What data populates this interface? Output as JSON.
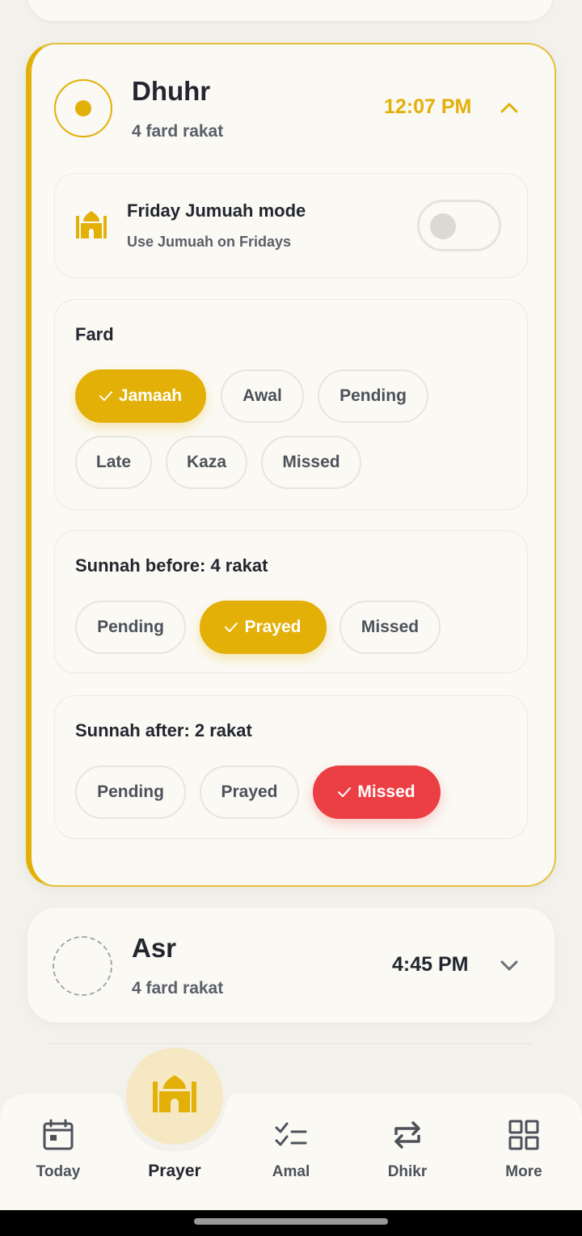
{
  "colors": {
    "accent": "#e2b007",
    "missed": "#ec3f44",
    "background": "#f3f1ec",
    "card": "#fbf9f4"
  },
  "dhuhr": {
    "name": "Dhuhr",
    "subtitle": "4 fard rakat",
    "time": "12:07 PM",
    "status_icon": "circle-dot-icon",
    "expand_icon": "chevron-up-icon",
    "jumuah": {
      "icon": "mosque-icon",
      "title": "Friday Jumuah mode",
      "subtitle": "Use Jumuah on Fridays",
      "enabled": false
    },
    "fard": {
      "title": "Fard",
      "options": [
        "Jamaah",
        "Awal",
        "Pending",
        "Late",
        "Kaza",
        "Missed"
      ],
      "selected": "Jamaah"
    },
    "sunnah_before": {
      "title": "Sunnah before: 4 rakat",
      "options": [
        "Pending",
        "Prayed",
        "Missed"
      ],
      "selected": "Prayed"
    },
    "sunnah_after": {
      "title": "Sunnah after: 2 rakat",
      "options": [
        "Pending",
        "Prayed",
        "Missed"
      ],
      "selected": "Missed"
    }
  },
  "asr": {
    "name": "Asr",
    "subtitle": "4 fard rakat",
    "time": "4:45 PM",
    "expand_icon": "chevron-down-icon"
  },
  "nav": {
    "items": [
      {
        "label": "Today",
        "icon": "calendar-icon"
      },
      {
        "label": "Prayer",
        "icon": "mosque-icon",
        "active": true
      },
      {
        "label": "Amal",
        "icon": "checklist-icon"
      },
      {
        "label": "Dhikr",
        "icon": "repeat-icon"
      },
      {
        "label": "More",
        "icon": "grid-icon"
      }
    ]
  }
}
